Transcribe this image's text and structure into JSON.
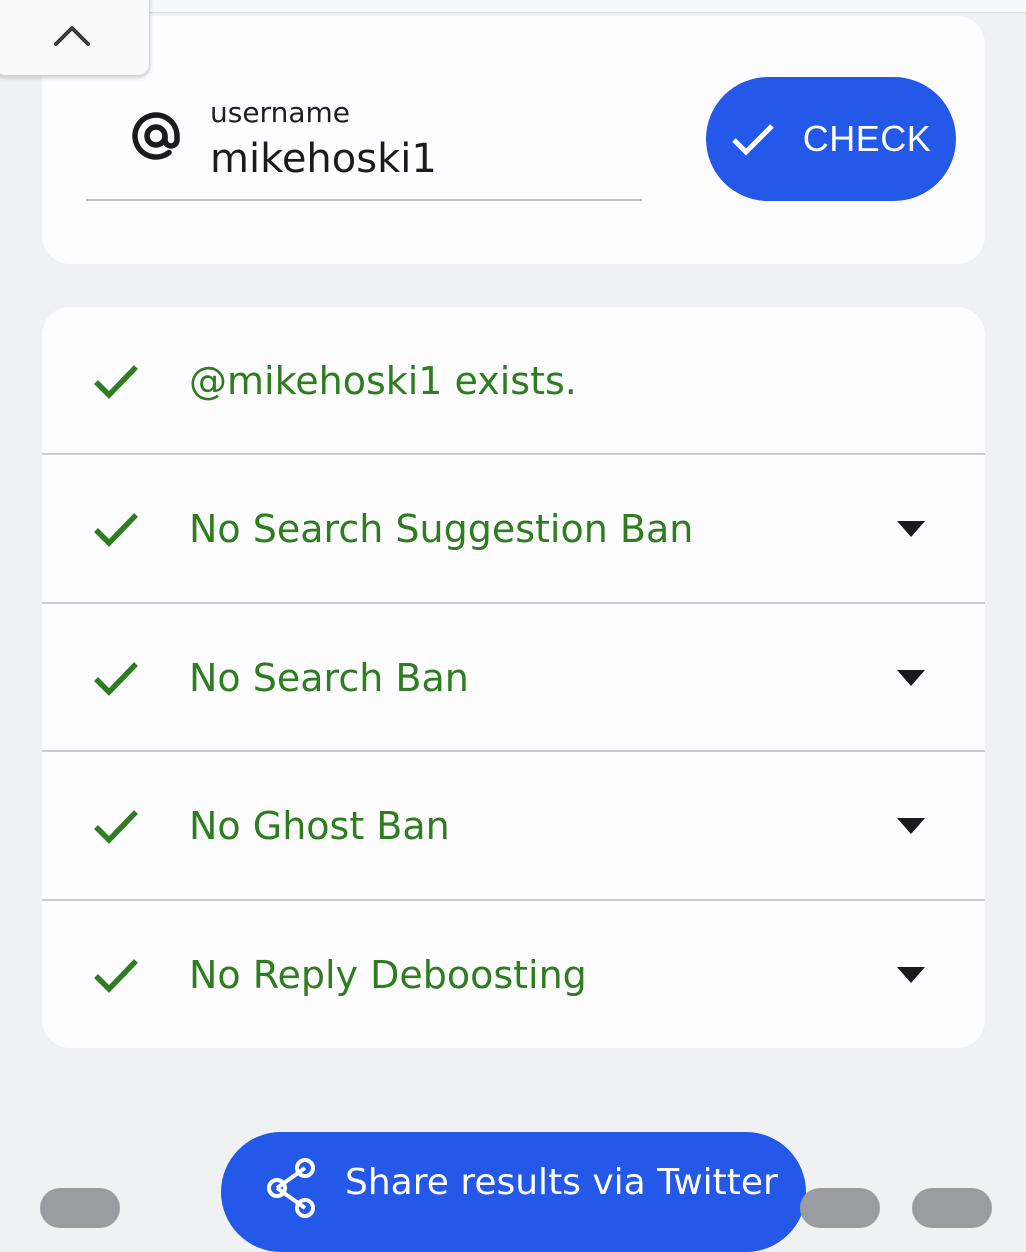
{
  "colors": {
    "accent": "#2458e8",
    "success": "#2e7d1e",
    "background": "#f0f1f3",
    "card": "#fdfcff"
  },
  "collapse": {
    "icon": "chevron-up-icon"
  },
  "username_field": {
    "icon": "at-sign-icon",
    "label": "username",
    "value": "mikehoski1"
  },
  "check_button": {
    "icon": "checkmark-icon",
    "label": "CHECK"
  },
  "results": [
    {
      "text": "@mikehoski1 exists.",
      "icon": "checkmark-icon",
      "expandable": false
    },
    {
      "text": "No Search Suggestion Ban",
      "icon": "checkmark-icon",
      "expandable": true
    },
    {
      "text": "No Search Ban",
      "icon": "checkmark-icon",
      "expandable": true
    },
    {
      "text": "No Ghost Ban",
      "icon": "checkmark-icon",
      "expandable": true
    },
    {
      "text": "No Reply Deboosting",
      "icon": "checkmark-icon",
      "expandable": true
    }
  ],
  "share_button": {
    "icon": "share-icon",
    "label": "Share results via Twitter"
  }
}
